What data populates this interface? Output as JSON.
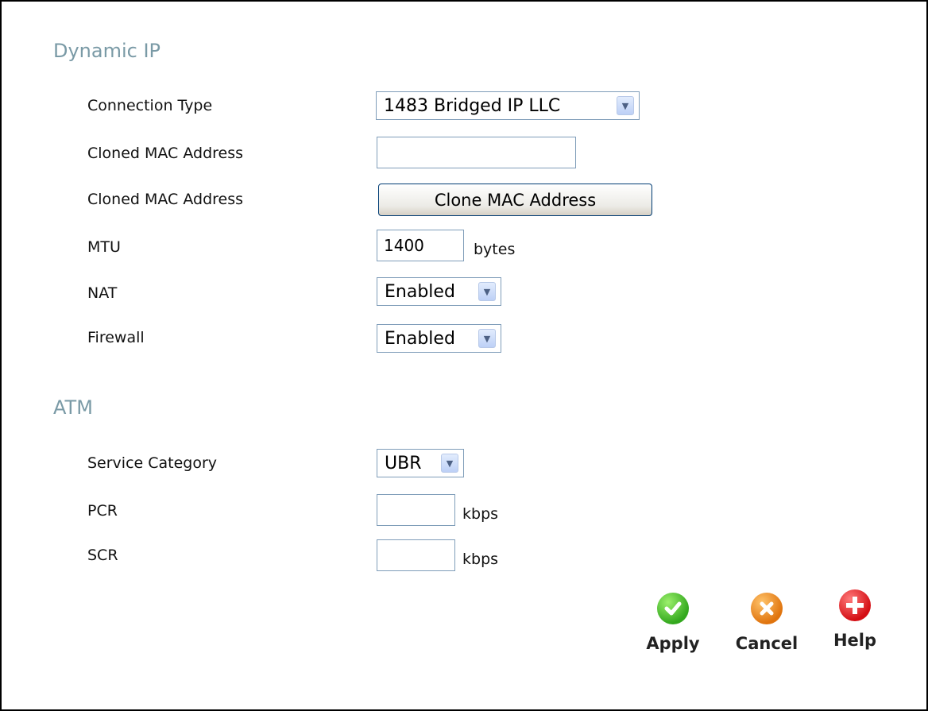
{
  "sections": {
    "dynamic_ip": "Dynamic IP",
    "atm": "ATM"
  },
  "fields": {
    "connection_type": {
      "label": "Connection Type",
      "value": "1483 Bridged IP LLC"
    },
    "cloned_mac": {
      "label": "Cloned MAC Address",
      "value": ""
    },
    "clone_button": {
      "label": "Cloned MAC Address",
      "button": "Clone MAC Address"
    },
    "mtu": {
      "label": "MTU",
      "value": "1400",
      "unit": "bytes"
    },
    "nat": {
      "label": "NAT",
      "value": "Enabled"
    },
    "firewall": {
      "label": "Firewall",
      "value": "Enabled"
    },
    "service_category": {
      "label": "Service Category",
      "value": "UBR"
    },
    "pcr": {
      "label": "PCR",
      "value": "",
      "unit": "kbps"
    },
    "scr": {
      "label": "SCR",
      "value": "",
      "unit": "kbps"
    }
  },
  "actions": {
    "apply": "Apply",
    "cancel": "Cancel",
    "help": "Help"
  },
  "icons": {
    "dropdown": "chevron-down-icon",
    "apply": "checkmark-icon",
    "cancel": "x-icon",
    "help": "plus-icon"
  },
  "colors": {
    "section_title": "#7a9aa6",
    "apply": "#33a81e",
    "cancel": "#e0740e",
    "help": "#d40e14"
  }
}
